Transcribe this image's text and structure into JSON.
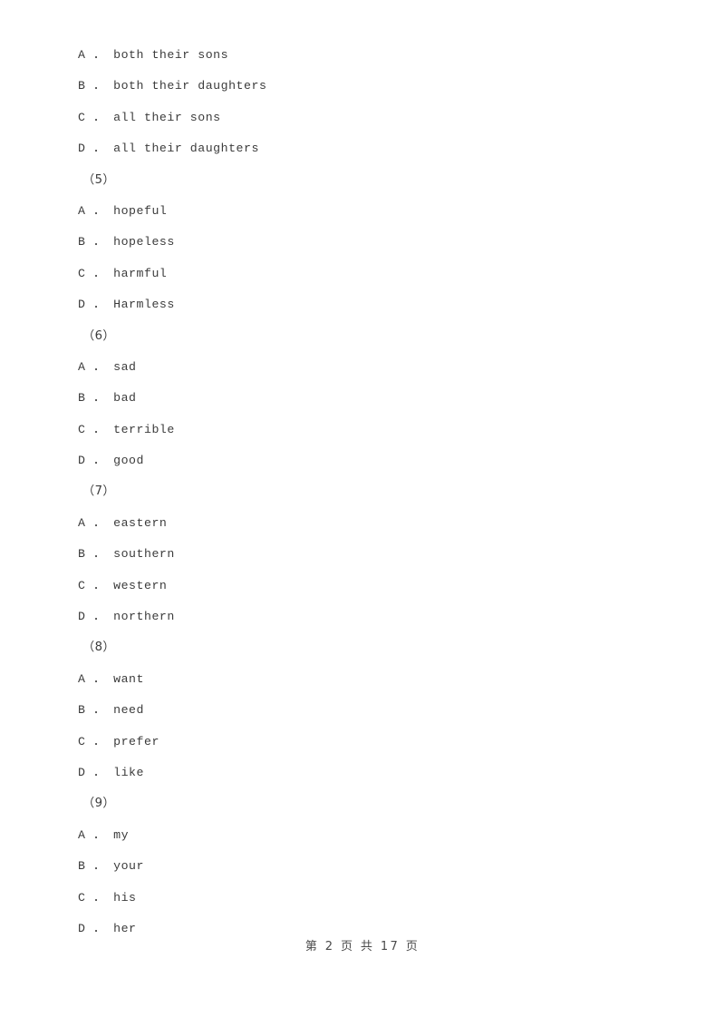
{
  "document": {
    "page_background": "#ffffff",
    "text_color": "#3b3b3b"
  },
  "question_groups": [
    {
      "number_label": "",
      "options": [
        "A ． both their sons",
        "B ． both their daughters",
        "C ． all their sons",
        "D ． all their daughters"
      ]
    },
    {
      "number_label": "（5）",
      "options": [
        "A ． hopeful",
        "B ． hopeless",
        "C ． harmful",
        "D ． Harmless"
      ]
    },
    {
      "number_label": "（6）",
      "options": [
        "A ． sad",
        "B ． bad",
        "C ． terrible",
        "D ． good"
      ]
    },
    {
      "number_label": "（7）",
      "options": [
        "A ． eastern",
        "B ． southern",
        "C ． western",
        "D ． northern"
      ]
    },
    {
      "number_label": "（8）",
      "options": [
        "A ． want",
        "B ． need",
        "C ． prefer",
        "D ． like"
      ]
    },
    {
      "number_label": "（9）",
      "options": [
        "A ． my",
        "B ． your",
        "C ． his",
        "D ． her"
      ]
    }
  ],
  "footer": {
    "page_label": "第 2 页 共 17 页"
  }
}
